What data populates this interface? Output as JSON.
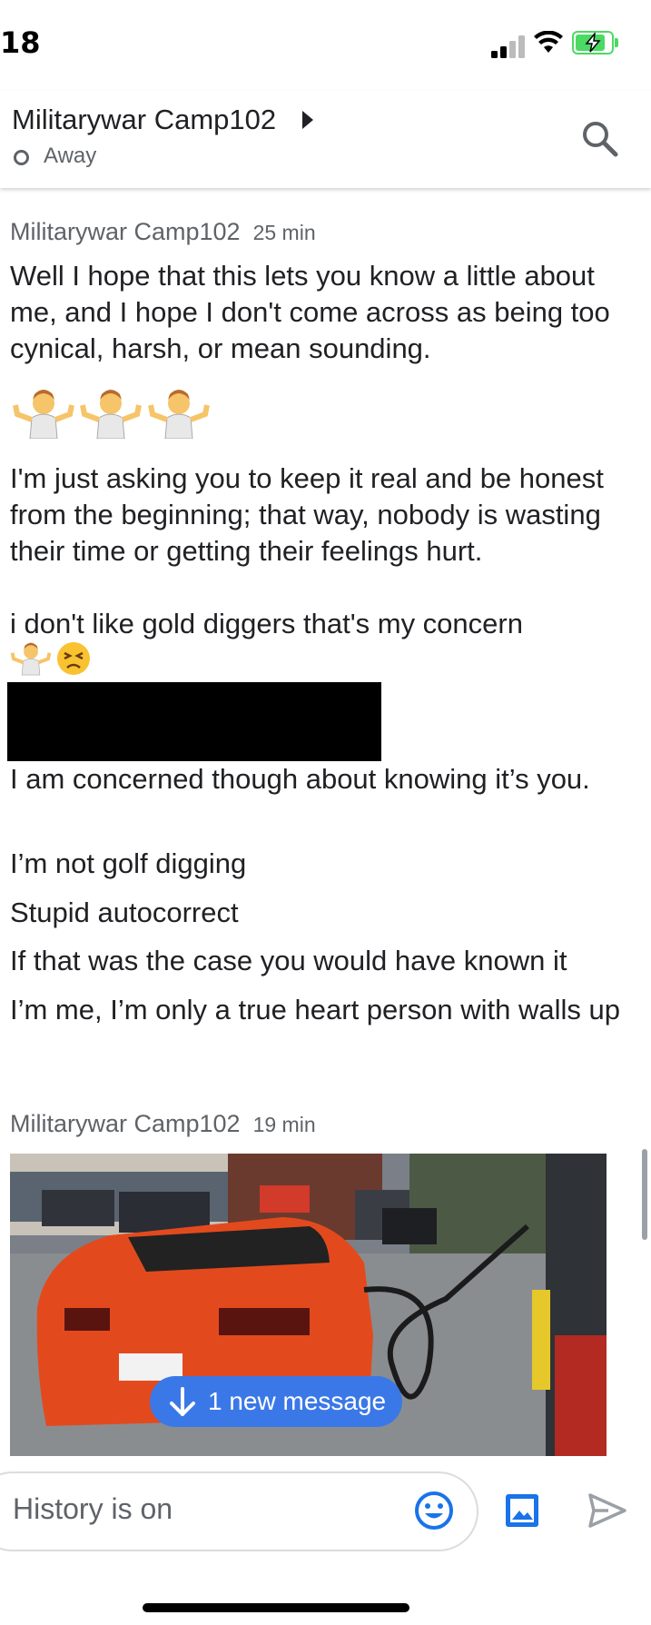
{
  "status_bar": {
    "time": "18"
  },
  "header": {
    "contact_name": "Militarywar Camp102",
    "presence": "Away"
  },
  "messages": {
    "group1": {
      "sender": "Militarywar Camp102",
      "time": "25 min",
      "p1": "Well I hope that this lets you know a little about me, and I hope I don't come across as being too cynical, harsh, or mean sounding.",
      "p2": "I'm just asking you to keep it real and be honest from the beginning; that way, nobody is wasting their time or getting their feelings hurt.",
      "p3": "i don't like gold diggers that's my concern",
      "p4": "I am concerned though about knowing it’s you.",
      "p5": "I’m not golf digging",
      "p6": "Stupid autocorrect",
      "p7": "If that was the case you would have known it",
      "p8": "I’m me, I’m only a true heart person with walls up"
    },
    "group2": {
      "sender": "Militarywar Camp102",
      "time": "19 min"
    }
  },
  "new_message_pill": "1 new message",
  "composer": {
    "placeholder": "History is on"
  },
  "icons": {
    "emoji": "smiley-icon",
    "image": "image-icon",
    "send": "send-icon",
    "search": "search-icon"
  },
  "colors": {
    "accent": "#3b78e7",
    "battery": "#4cd964"
  }
}
